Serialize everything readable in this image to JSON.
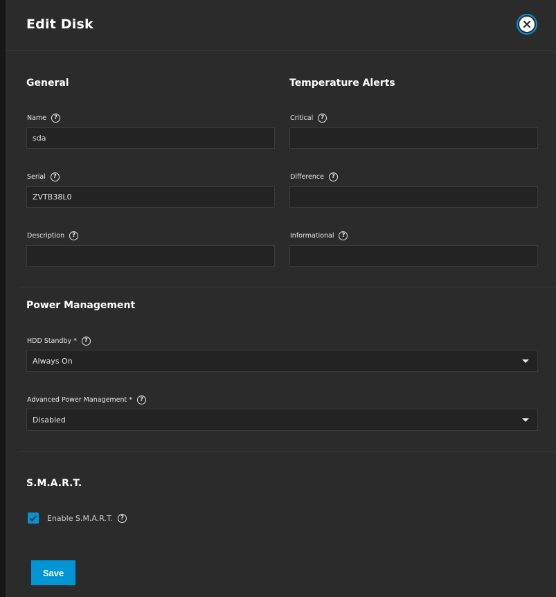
{
  "dialog": {
    "title": "Edit Disk"
  },
  "general": {
    "title": "General",
    "name_label": "Name",
    "name_value": "sda",
    "serial_label": "Serial",
    "serial_value": "ZVTB38L0",
    "description_label": "Description",
    "description_value": ""
  },
  "temperature": {
    "title": "Temperature Alerts",
    "critical_label": "Critical",
    "critical_value": "",
    "difference_label": "Difference",
    "difference_value": "",
    "informational_label": "Informational",
    "informational_value": ""
  },
  "power": {
    "title": "Power Management",
    "hdd_standby_label": "HDD Standby *",
    "hdd_standby_value": "Always On",
    "apm_label": "Advanced Power Management *",
    "apm_value": "Disabled"
  },
  "smart": {
    "title": "S.M.A.R.T.",
    "enable_label": "Enable S.M.A.R.T.",
    "enabled": true
  },
  "actions": {
    "save_label": "Save"
  },
  "colors": {
    "accent": "#0095d5",
    "panel": "#2b2b2b",
    "input": "#232323"
  },
  "icons": {
    "help": "question-circle-icon",
    "close": "close-icon",
    "caret": "caret-down-icon",
    "check": "check-icon"
  }
}
